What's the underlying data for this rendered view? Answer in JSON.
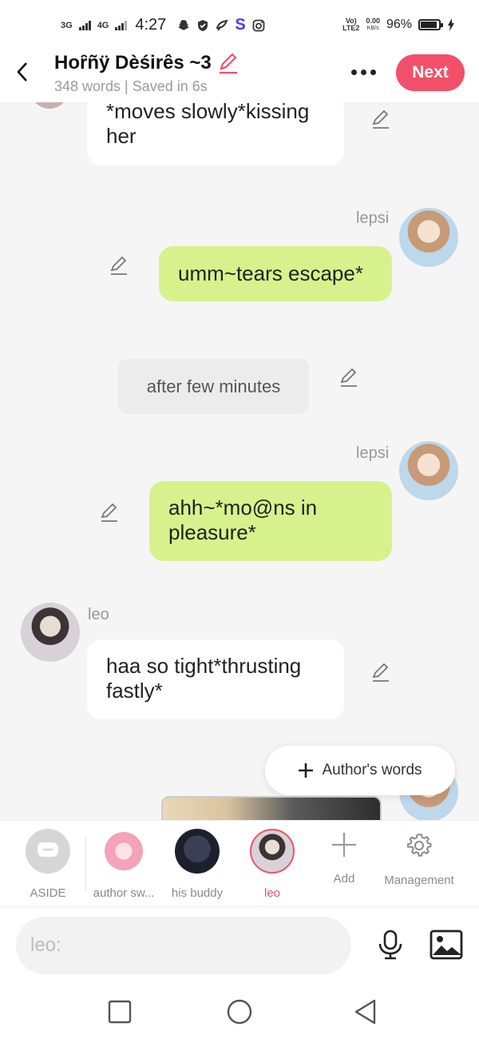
{
  "status_bar": {
    "network_1": "3G",
    "network_2": "4G",
    "time": "4:27",
    "volte_1": "Vo)",
    "volte_2": "LTE2",
    "speed_value": "0.00",
    "speed_unit": "KB/s",
    "battery": "96%",
    "icons": [
      "snapchat-icon",
      "shield-icon",
      "app-icon",
      "s-app-icon",
      "instagram-icon",
      "battery-icon",
      "charging-icon"
    ]
  },
  "header": {
    "title": "Hoȓñÿ Dèśirês ~3",
    "subtitle": "348 words | Saved in 6s",
    "next_label": "Next",
    "accent_color": "#f2506a"
  },
  "messages": [
    {
      "speaker": "",
      "type": "white",
      "text": "*moves slowly*kissing her"
    },
    {
      "speaker": "lepsi",
      "type": "green",
      "text": "umm~tears escape*"
    },
    {
      "speaker": "",
      "type": "aside",
      "text": "after few minutes"
    },
    {
      "speaker": "lepsi",
      "type": "green",
      "text": "ahh~*mo@ns in pleasure*"
    },
    {
      "speaker": "leo",
      "type": "white",
      "text": "haa so tight*thrusting fastly*"
    }
  ],
  "add_author_words": "Author's words",
  "characters": [
    {
      "label": "ASIDE",
      "active": false
    },
    {
      "label": "author sw...",
      "active": false
    },
    {
      "label": "his buddy",
      "active": false
    },
    {
      "label": "leo",
      "active": true
    }
  ],
  "tools": {
    "add_label": "Add",
    "management_label": "Management"
  },
  "input": {
    "placeholder": "leo:"
  },
  "colors": {
    "user_bubble": "#d7f28c",
    "other_bubble": "#ffffff",
    "background": "#f5f5f5"
  }
}
